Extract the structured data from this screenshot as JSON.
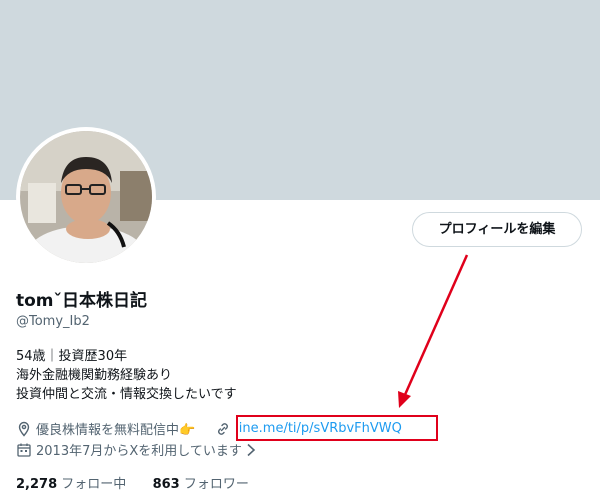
{
  "profile": {
    "name": "tomˇ日本株日記",
    "handle": "@Tomy_Ib2",
    "edit_button": "プロフィールを編集",
    "bio": [
      "54歳｜投資歴30年",
      "海外金融機関勤務経験あり",
      "投資仲間と交流・情報交換したいです"
    ],
    "location": "優良株情報を無料配信中👉",
    "website": "line.me/ti/p/sVRbvFhVWQ",
    "joined": "2013年7月からXを利用しています",
    "following_count": "2,278",
    "following_label": "フォロー中",
    "followers_count": "863",
    "followers_label": "フォロワー"
  },
  "annotation": {
    "color": "#e0001b"
  }
}
